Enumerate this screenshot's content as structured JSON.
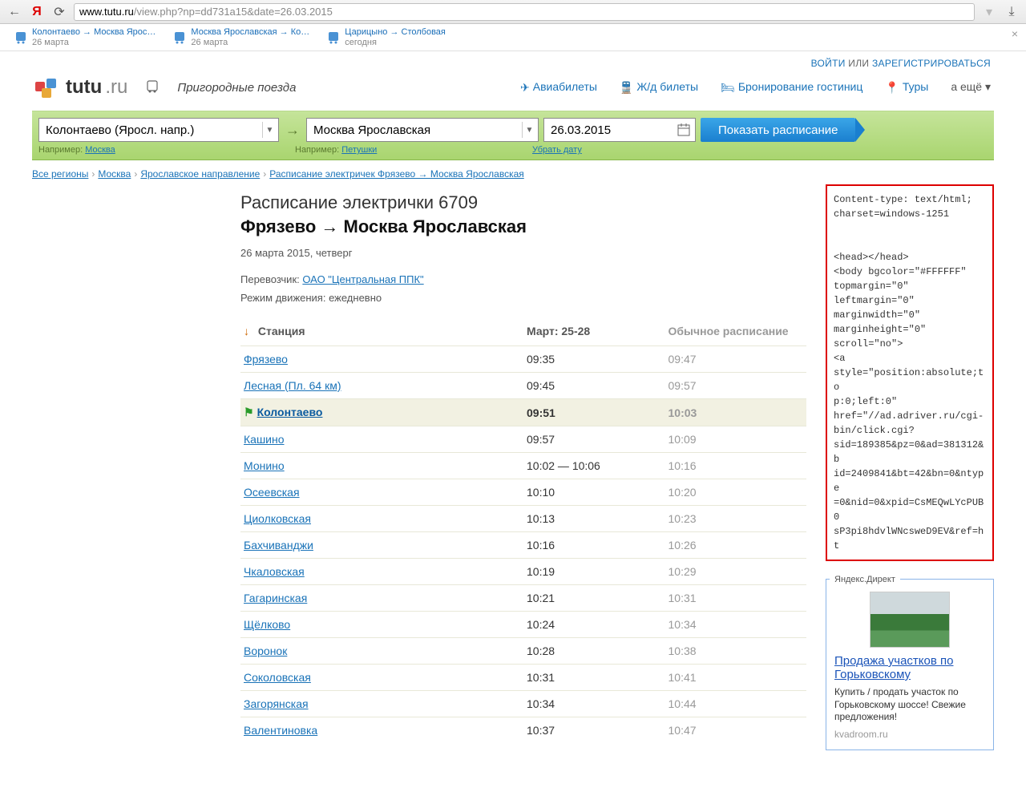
{
  "browser": {
    "url_host": "www.tutu.ru",
    "url_path": "/view.php?np=dd731a15&date=26.03.2015"
  },
  "tabs": [
    {
      "title": "Колонтаево → Москва Ярос…",
      "sub": "26 марта"
    },
    {
      "title": "Москва Ярославская → Ко…",
      "sub": "26 марта"
    },
    {
      "title": "Царицыно → Столбовая",
      "sub": "сегодня"
    }
  ],
  "top_links": {
    "login": "ВОЙТИ",
    "or": " или ",
    "register": "ЗАРЕГИСТРИРОВАТЬСЯ"
  },
  "header": {
    "logo": "tutu",
    "logo_suffix": ".ru",
    "subtitle": "Пригородные поезда",
    "nav": {
      "avia": "Авиабилеты",
      "rail": "Ж/д билеты",
      "hotel": "Бронирование гостиниц",
      "tours": "Туры",
      "more": "а ещё ▾"
    }
  },
  "search": {
    "from": "Колонтаево (Яросл. напр.)",
    "to": "Москва Ярославская",
    "date": "26.03.2015",
    "button": "Показать расписание",
    "eg_label": "Например: ",
    "eg_from": "Москва",
    "eg_to": "Петушки",
    "clear_date": "Убрать дату"
  },
  "breadcrumb": [
    "Все регионы",
    "Москва",
    "Ярославское направление",
    "Расписание электричек Фрязево → Москва Ярославская"
  ],
  "page": {
    "title": "Расписание электрички 6709",
    "route": "Фрязево → Москва Ярославская",
    "date": "26 марта 2015, четверг",
    "carrier_label": "Перевозчик: ",
    "carrier": "ОАО \"Центральная ППК\"",
    "mode_label": "Режим движения: ",
    "mode": "ежедневно"
  },
  "table": {
    "h_station": "Станция",
    "h_date": "Март: 25-28",
    "h_usual": "Обычное расписание",
    "rows": [
      {
        "station": "Фрязево",
        "t1": "09:35",
        "t2": "09:47"
      },
      {
        "station": "Лесная (Пл. 64 км)",
        "t1": "09:45",
        "t2": "09:57"
      },
      {
        "station": "Колонтаево",
        "t1": "09:51",
        "t2": "10:03",
        "current": true
      },
      {
        "station": "Кашино",
        "t1": "09:57",
        "t2": "10:09"
      },
      {
        "station": "Монино",
        "t1": "10:02 — 10:06",
        "t2": "10:16"
      },
      {
        "station": "Осеевская",
        "t1": "10:10",
        "t2": "10:20"
      },
      {
        "station": "Циолковская",
        "t1": "10:13",
        "t2": "10:23"
      },
      {
        "station": "Бахчиванджи",
        "t1": "10:16",
        "t2": "10:26"
      },
      {
        "station": "Чкаловская",
        "t1": "10:19",
        "t2": "10:29"
      },
      {
        "station": "Гагаринская",
        "t1": "10:21",
        "t2": "10:31"
      },
      {
        "station": "Щёлково",
        "t1": "10:24",
        "t2": "10:34"
      },
      {
        "station": "Воронок",
        "t1": "10:28",
        "t2": "10:38"
      },
      {
        "station": "Соколовская",
        "t1": "10:31",
        "t2": "10:41"
      },
      {
        "station": "Загорянская",
        "t1": "10:34",
        "t2": "10:44"
      },
      {
        "station": "Валентиновка",
        "t1": "10:37",
        "t2": "10:47"
      }
    ]
  },
  "code_box": "Content-type: text/html;\ncharset=windows-1251\n\n\n<head></head>\n<body bgcolor=\"#FFFFFF\"\ntopmargin=\"0\"\nleftmargin=\"0\"\nmarginwidth=\"0\"\nmarginheight=\"0\"\nscroll=\"no\">\n<a\nstyle=\"position:absolute;to\np:0;left:0\"\nhref=\"//ad.adriver.ru/cgi-\nbin/click.cgi?\nsid=189385&pz=0&ad=381312&b\nid=2409841&bt=42&bn=0&ntype\n=0&nid=0&xpid=CsMEQwLYcPUB0\nsP3pi8hdvlWNcsweD9EV&ref=ht",
  "ad": {
    "label": "Яндекс.Директ",
    "title": "Продажа участков по Горьковскому",
    "text": "Купить / продать участок по Горьковскому шоссе! Свежие предложения!",
    "domain": "kvadroom.ru"
  }
}
